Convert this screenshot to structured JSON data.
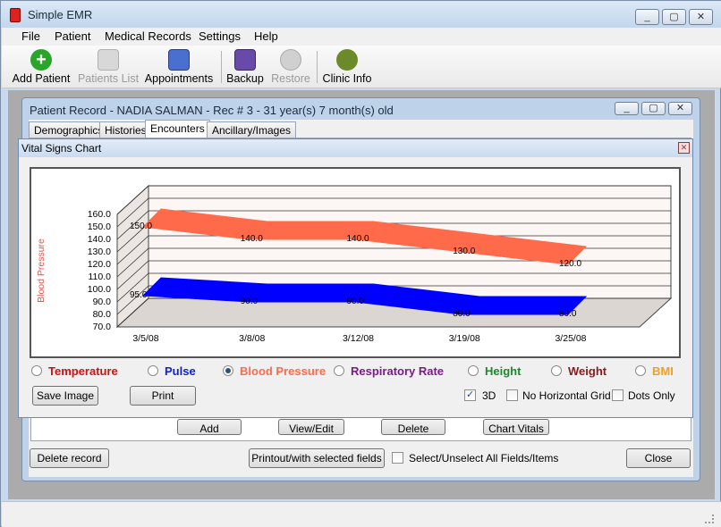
{
  "window": {
    "title": "Simple EMR",
    "controls": [
      "_",
      "▢",
      "✕"
    ]
  },
  "menu": [
    "File",
    "Patient",
    "Medical Records",
    "Settings",
    "Help"
  ],
  "toolbar": {
    "add_patient": "Add Patient",
    "patients_list": "Patients List",
    "appointments": "Appointments",
    "backup": "Backup",
    "restore": "Restore",
    "clinic_info": "Clinic Info"
  },
  "patient_record": {
    "title": "Patient Record - NADIA SALMAN - Rec # 3 - 31 year(s) 7 month(s) old",
    "tabs": [
      "Demographics",
      "Histories",
      "Encounters",
      "Ancillary/Images"
    ],
    "selected_tab": "Encounters",
    "hidden_buttons": [
      "Add",
      "View/Edit",
      "Delete",
      "Chart Vitals"
    ],
    "delete_record": "Delete record",
    "printout": "Printout/with selected fields",
    "select_all": "Select/Unselect All Fields/Items",
    "close": "Close"
  },
  "vitals_dialog": {
    "title": "Vital Signs Chart",
    "close_glyph": "✕",
    "radios": [
      {
        "label": "Temperature",
        "color": "#cc1111",
        "selected": false
      },
      {
        "label": "Pulse",
        "color": "#1122cc",
        "selected": false
      },
      {
        "label": "Blood Pressure",
        "color": "#ff6a4a",
        "selected": true
      },
      {
        "label": "Respiratory Rate",
        "color": "#7a1a8a",
        "selected": false
      },
      {
        "label": "Height",
        "color": "#1a8a2a",
        "selected": false
      },
      {
        "label": "Weight",
        "color": "#8a1a1a",
        "selected": false
      },
      {
        "label": "BMI",
        "color": "#f0a020",
        "selected": false
      }
    ],
    "save_image": "Save Image",
    "print": "Print",
    "checks": [
      {
        "label": "3D",
        "checked": true
      },
      {
        "label": "No Horizontal Grid",
        "checked": false
      },
      {
        "label": "Dots Only",
        "checked": false
      }
    ]
  },
  "chart_data": {
    "type": "area",
    "three_d": true,
    "ylabel": "Blood Pressure",
    "categories": [
      "3/5/08",
      "3/8/08",
      "3/12/08",
      "3/19/08",
      "3/25/08"
    ],
    "yticks": [
      "160.0",
      "150.0",
      "140.0",
      "130.0",
      "120.0",
      "110.0",
      "100.0",
      "90.0",
      "80.0",
      "70.0"
    ],
    "ylim": [
      70,
      160
    ],
    "grid": true,
    "series": [
      {
        "values": [
          150.0,
          140.0,
          140.0,
          130.0,
          120.0
        ],
        "labels": [
          "150.0",
          "140.0",
          "140.0",
          "130.0",
          "120.0"
        ],
        "color": "#ff6a4a"
      },
      {
        "values": [
          95.0,
          90.0,
          90.0,
          80.0,
          80.0
        ],
        "labels": [
          "95.0",
          "90.0",
          "90.0",
          "80.0",
          "80.0"
        ],
        "color": "#0000ff"
      }
    ]
  }
}
